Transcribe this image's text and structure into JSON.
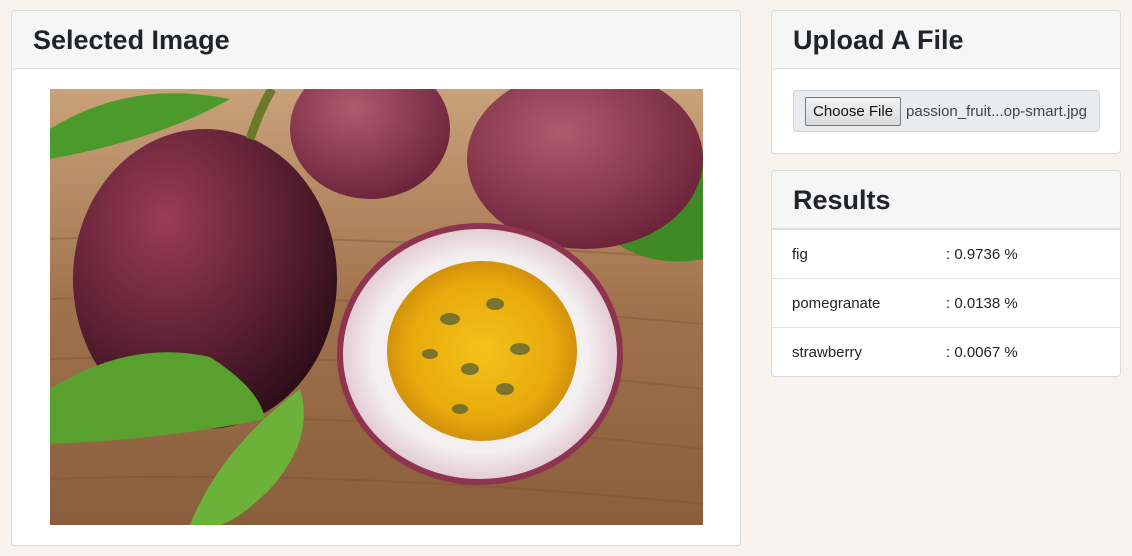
{
  "selected_image": {
    "title": "Selected Image",
    "image_alt": "passion fruit photo"
  },
  "upload": {
    "title": "Upload A File",
    "choose_label": "Choose File",
    "file_name": "passion_fruit...op-smart.jpg"
  },
  "results": {
    "title": "Results",
    "items": [
      {
        "label": "fig",
        "value": ": 0.9736 %"
      },
      {
        "label": "pomegranate",
        "value": ": 0.0138 %"
      },
      {
        "label": "strawberry",
        "value": ": 0.0067 %"
      }
    ]
  },
  "colors": {
    "page_background": "#f8f2ec",
    "card_header": "#f6f6f6",
    "file_input_background": "#e9ecef"
  }
}
